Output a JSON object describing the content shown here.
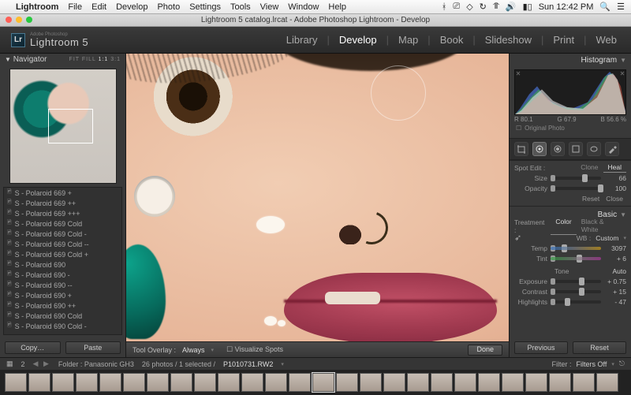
{
  "menubar": {
    "items": [
      "Lightroom",
      "File",
      "Edit",
      "Develop",
      "Photo",
      "Settings",
      "Tools",
      "View",
      "Window",
      "Help"
    ],
    "clock": "Sun 12:42 PM"
  },
  "titlebar": "Lightroom 5 catalog.lrcat - Adobe Photoshop Lightroom - Develop",
  "identity": {
    "adobe": "Adobe Photoshop",
    "product": "Lightroom 5"
  },
  "modules": [
    "Library",
    "Develop",
    "Map",
    "Book",
    "Slideshow",
    "Print",
    "Web"
  ],
  "module_active": "Develop",
  "left": {
    "navigator": {
      "title": "Navigator",
      "modes": [
        "FIT",
        "FILL",
        "1:1",
        "3:1"
      ]
    },
    "presets": [
      "S - Polaroid 669 +",
      "S - Polaroid 669 ++",
      "S - Polaroid 669 +++",
      "S - Polaroid 669 Cold",
      "S - Polaroid 669 Cold -",
      "S - Polaroid 669 Cold --",
      "S - Polaroid 669 Cold +",
      "S - Polaroid 690",
      "S - Polaroid 690 -",
      "S - Polaroid 690 --",
      "S - Polaroid 690 +",
      "S - Polaroid 690 ++",
      "S - Polaroid 690 Cold",
      "S - Polaroid 690 Cold -"
    ],
    "copy": "Copy…",
    "paste": "Paste"
  },
  "toolbar": {
    "overlay_label": "Tool Overlay :",
    "overlay_value": "Always",
    "visualize": "Visualize Spots",
    "done": "Done"
  },
  "right": {
    "histo_title": "Histogram",
    "rgb": {
      "r": "R  80.1",
      "g": "G  67.9",
      "b": "B  56.6 %"
    },
    "original": "Original Photo",
    "spot": {
      "title": "Spot Edit :",
      "clone": "Clone",
      "heal": "Heal",
      "size_label": "Size",
      "size_value": "66",
      "opacity_label": "Opacity",
      "opacity_value": "100",
      "reset": "Reset",
      "close": "Close"
    },
    "basic": {
      "title": "Basic",
      "treatment": "Treatment :",
      "color": "Color",
      "bw": "Black & White",
      "wb_label": "WB :",
      "wb_value": "Custom",
      "temp_label": "Temp",
      "temp_value": "3097",
      "tint_label": "Tint",
      "tint_value": "+ 6",
      "tone": "Tone",
      "auto": "Auto",
      "exposure_label": "Exposure",
      "exposure_value": "+ 0.75",
      "contrast_label": "Contrast",
      "contrast_value": "+ 15",
      "highlights_label": "Highlights",
      "highlights_value": "- 47"
    },
    "previous": "Previous",
    "reset": "Reset"
  },
  "status": {
    "pages": "2",
    "folder": "Folder : Panasonic GH3",
    "count": "26 photos / 1 selected /",
    "file": "P1010731.RW2",
    "filter": "Filter :",
    "filtermode": "Filters Off"
  }
}
